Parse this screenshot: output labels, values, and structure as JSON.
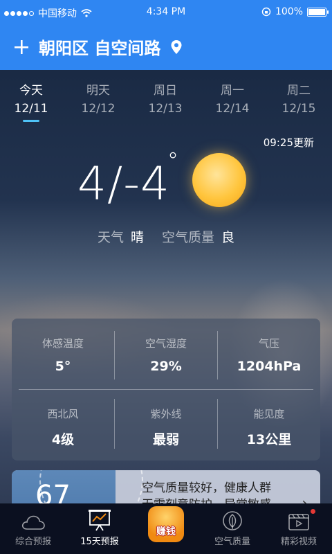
{
  "status_bar": {
    "carrier": "中国移动",
    "time": "4:34 PM",
    "battery": "100%"
  },
  "header": {
    "add_label": "+",
    "location": "朝阳区 自空间路"
  },
  "days": [
    {
      "name": "今天",
      "date": "12/11"
    },
    {
      "name": "明天",
      "date": "12/12"
    },
    {
      "name": "周日",
      "date": "12/13"
    },
    {
      "name": "周一",
      "date": "12/14"
    },
    {
      "name": "周二",
      "date": "12/15"
    }
  ],
  "current": {
    "updated": "09:25更新",
    "temp_range": "4/-4",
    "degree": "°",
    "weather_label": "天气",
    "weather_value": "晴",
    "aqi_label": "空气质量",
    "aqi_value": "良"
  },
  "details": [
    {
      "label": "体感温度",
      "value": "5°"
    },
    {
      "label": "空气湿度",
      "value": "29%"
    },
    {
      "label": "气压",
      "value": "1204hPa"
    },
    {
      "label": "西北风",
      "value": "4级"
    },
    {
      "label": "紫外线",
      "value": "最弱"
    },
    {
      "label": "能见度",
      "value": "13公里"
    }
  ],
  "aqi_card": {
    "value": "67",
    "text_line1": "空气质量较好，健康人群",
    "text_line2": "无需刻意防护，异常敏感",
    "chevron": "›"
  },
  "tabs": [
    {
      "label": "综合预报",
      "icon": "cloud-icon"
    },
    {
      "label": "15天预报",
      "icon": "chart-board-icon"
    },
    {
      "label": "赚钱",
      "icon": "money-bag-icon"
    },
    {
      "label": "空气质量",
      "icon": "leaf-icon"
    },
    {
      "label": "精彩视频",
      "icon": "video-icon"
    }
  ],
  "colors": {
    "header_blue": "#2f86f2",
    "active_underline": "#4fc3f7",
    "tab_bar": "#0b1020"
  }
}
